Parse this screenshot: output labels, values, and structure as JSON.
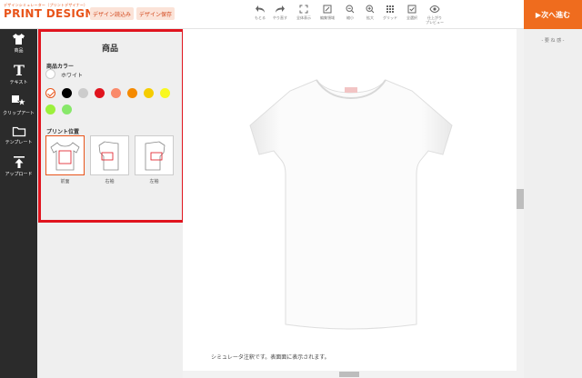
{
  "header": {
    "logo_sub": "デザインシミュレーター（プリントデザイナー）",
    "logo": "PRINT DESIGNER",
    "load_button": "デザイン読込み",
    "save_button": "デザイン保存",
    "tools": [
      {
        "label": "もとる",
        "icon": "undo-icon"
      },
      {
        "label": "やり直す",
        "icon": "redo-icon"
      },
      {
        "label": "全体表示",
        "icon": "fit-screen-icon"
      },
      {
        "label": "編集領域",
        "icon": "edit-area-icon"
      },
      {
        "label": "縮小",
        "icon": "zoom-out-icon"
      },
      {
        "label": "拡大",
        "icon": "zoom-in-icon"
      },
      {
        "label": "グリッド",
        "icon": "grid-icon"
      },
      {
        "label": "全選択",
        "icon": "select-all-icon"
      },
      {
        "label": "仕上がり",
        "label2": "プレビュー",
        "icon": "eye-icon"
      }
    ],
    "next_button": "▶次へ進む"
  },
  "sidebar": {
    "items": [
      {
        "label": "商品",
        "icon": "tshirt-icon"
      },
      {
        "label": "テキスト",
        "icon": "text-icon"
      },
      {
        "label": "クリップアート",
        "icon": "clipart-icon"
      },
      {
        "label": "テンプレート",
        "icon": "folder-icon"
      },
      {
        "label": "アップロード",
        "icon": "upload-icon"
      }
    ]
  },
  "panel": {
    "title": "商品",
    "color_label": "商品カラー",
    "current_color": "ホワイト",
    "swatches": [
      "#ffffff",
      "#000000",
      "#cccccc",
      "#e0141e",
      "#fa8a6a",
      "#f58a00",
      "#f5cc00",
      "#f8f820",
      "#9cf03c",
      "#88e86a"
    ],
    "print_position_label": "プリント位置",
    "positions": [
      {
        "label": "前面",
        "selected": true
      },
      {
        "label": "右袖",
        "selected": false
      },
      {
        "label": "左袖",
        "selected": false
      }
    ]
  },
  "canvas": {
    "note": "シミュレータ注釈です。表面面に表示されます。"
  },
  "right_panel": {
    "note": "- 要 ね 感 -"
  },
  "colors": {
    "accent": "#ef6c1e",
    "highlight": "#e0141e",
    "sidebar_bg": "#2b2b2b"
  }
}
